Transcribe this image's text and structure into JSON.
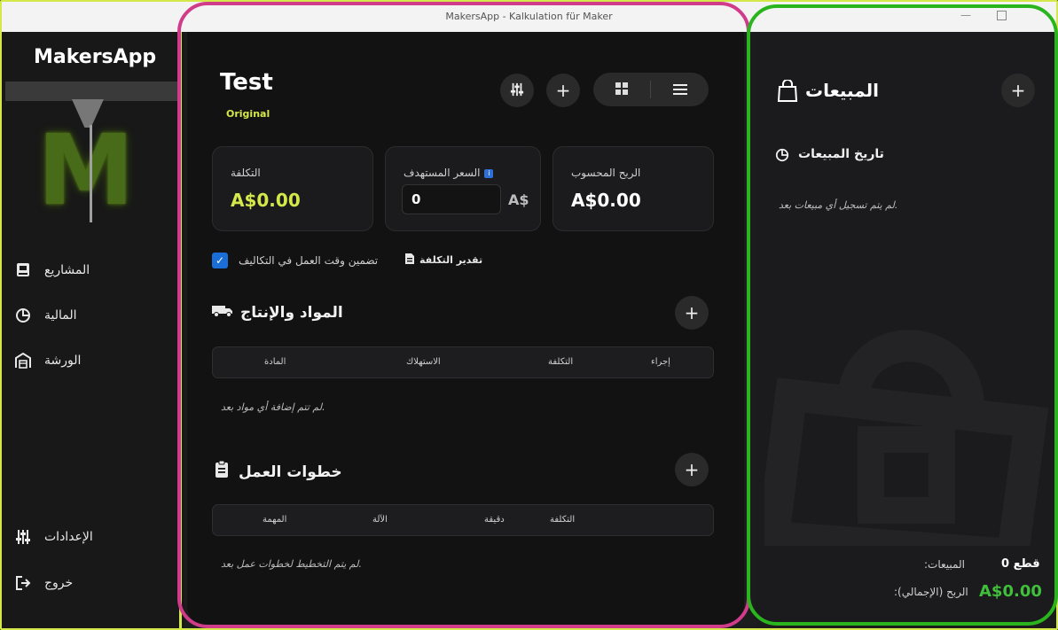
{
  "window": {
    "title": "MakersApp - Kalkulation für Maker"
  },
  "sidebar": {
    "logo": "MakersApp",
    "logo_letter": "M",
    "items": [
      {
        "label": "المشاريع",
        "icon": "book-icon"
      },
      {
        "label": "المالية",
        "icon": "pie-chart-icon"
      },
      {
        "label": "الورشة",
        "icon": "warehouse-icon"
      }
    ],
    "bottom_items": [
      {
        "label": "الإعدادات",
        "icon": "sliders-icon"
      },
      {
        "label": "خروج",
        "icon": "logout-icon"
      }
    ]
  },
  "main": {
    "project_title": "Test",
    "project_badge": "Original",
    "cards": {
      "cost": {
        "label": "التكلفة",
        "value": "A$0.00"
      },
      "target_price": {
        "label": "السعر المستهدف",
        "input_value": "0",
        "currency": "A$"
      },
      "profit": {
        "label": "الربح المحسوب",
        "value": "A$0.00"
      }
    },
    "include_work_time_label": "تضمين وقت العمل في التكاليف",
    "estimate_label": "تقدير التكلفة",
    "materials": {
      "title": "المواد والإنتاج",
      "columns": [
        "إجراء",
        "التكلفة",
        "الاستهلاك",
        "المادة"
      ],
      "empty": "لم تتم إضافة أي مواد بعد."
    },
    "work_steps": {
      "title": "خطوات العمل",
      "columns": [
        "التكلفة",
        "دقيقة",
        "الآلة",
        "المهمة"
      ],
      "empty": "لم يتم التخطيط لخطوات عمل بعد."
    }
  },
  "sales": {
    "title": "المبيعات",
    "history_title": "تاريخ المبيعات",
    "history_empty": "لم يتم تسجيل أي مبيعات بعد.",
    "sales_label": ":المبيعات",
    "sales_value": "قطع 0",
    "profit_label": ":الربح (الإجمالي)",
    "profit_value": "A$0.00"
  },
  "colors": {
    "accent_yellow": "#d4e84a",
    "profit_green": "#3fbf3a",
    "checkbox_blue": "#1a6ed8"
  }
}
